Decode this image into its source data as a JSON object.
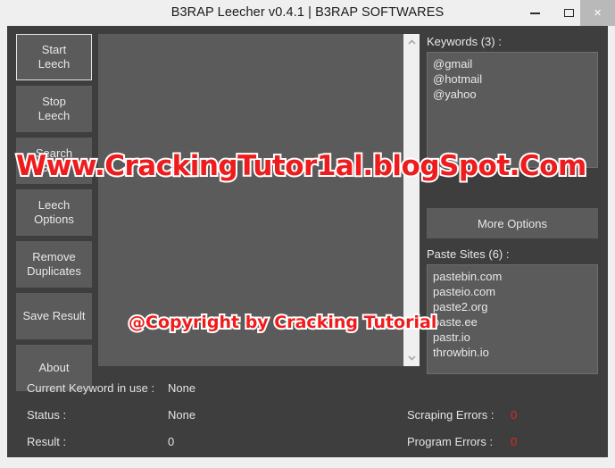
{
  "window": {
    "title": "B3RAP Leecher v0.4.1 | B3RAP SOFTWARES",
    "controls": {
      "minimize": "–",
      "maximize": "□",
      "close": "×"
    }
  },
  "sidebar": {
    "buttons": [
      {
        "label": "Start\nLeech",
        "focused": true
      },
      {
        "label": "Stop\nLeech",
        "focused": false
      },
      {
        "label": "Search\nSites",
        "focused": false
      },
      {
        "label": "Leech\nOptions",
        "focused": false
      },
      {
        "label": "Remove\nDuplicates",
        "focused": false
      },
      {
        "label": "Save Result",
        "focused": false
      },
      {
        "label": "About",
        "focused": false
      }
    ]
  },
  "center": {
    "items": [],
    "scrollbar": {
      "up_arrow": "▲",
      "down_arrow": "▼"
    }
  },
  "right": {
    "keywords_title": "Keywords (3) :",
    "keywords": [
      "@gmail",
      "@hotmail",
      "@yahoo"
    ],
    "more_options_label": "More Options",
    "paste_sites_title": "Paste Sites (6) :",
    "paste_sites": [
      "pastebin.com",
      "pasteio.com",
      "paste2.org",
      "paste.ee",
      "pastr.io",
      "throwbin.io"
    ]
  },
  "status": {
    "current_keyword_label": "Current Keyword in use :",
    "current_keyword_value": "None",
    "status_label": "Status :",
    "status_value": "None",
    "result_label": "Result :",
    "result_value": "0",
    "scraping_errors_label": "Scraping Errors :",
    "scraping_errors_value": "0",
    "program_errors_label": "Program Errors :",
    "program_errors_value": "0"
  },
  "watermarks": {
    "primary": "Www.CrackingTutor1al.blogSpot.Com",
    "secondary": "@Copyright by Cracking Tutorial"
  },
  "colors": {
    "app_background": "#3e3e3e",
    "panel_background": "#5b5b5b",
    "titlebar": "#efefef",
    "text": "#e8e8e8",
    "error": "#e02626",
    "watermark": "#ee1c1c"
  }
}
